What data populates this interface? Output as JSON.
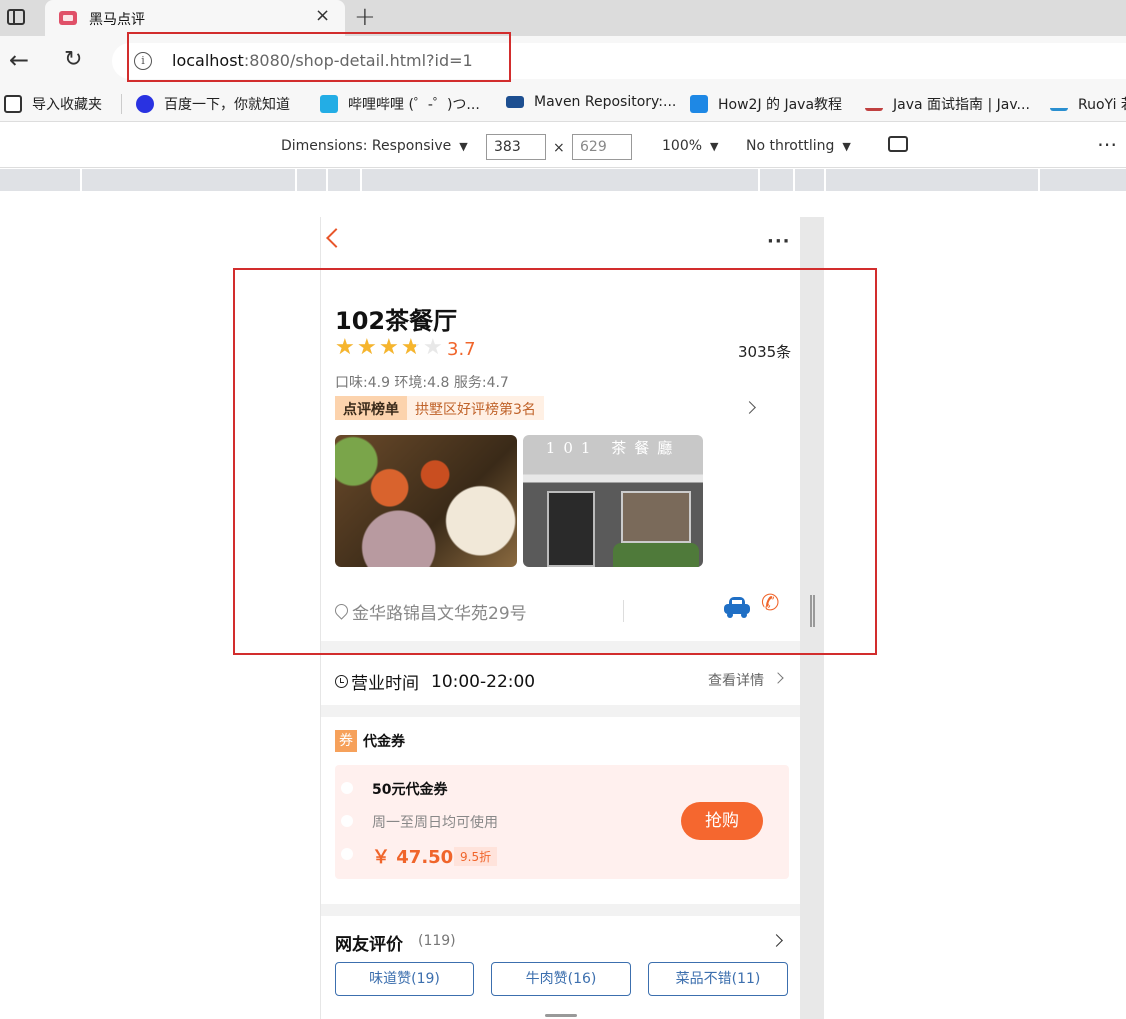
{
  "browser": {
    "tab_title": "黑马点评",
    "tab_close": "×",
    "new_tab": "+",
    "url_host": "localhost",
    "url_rest": ":8080/shop-detail.html?id=1",
    "back": "←",
    "reload": "↻",
    "info": "i"
  },
  "bookmarks": [
    {
      "label": "导入收藏夹",
      "icon": "import-icon",
      "color": "#333333"
    },
    {
      "label": "百度一下，你就知道",
      "icon": "baidu-icon",
      "color": "#2932e1"
    },
    {
      "label": "哔哩哔哩 (゜-゜)つ...",
      "icon": "bilibili-icon",
      "color": "#23ade5"
    },
    {
      "label": "Maven Repository:...",
      "icon": "maven-icon",
      "color": "#1d4f91"
    },
    {
      "label": "How2J 的 Java教程",
      "icon": "how2j-icon",
      "color": "#1e88e5"
    },
    {
      "label": "Java 面试指南 | Jav...",
      "icon": "java-guide-icon",
      "color": "#c04040"
    },
    {
      "label": "RuoYi 若",
      "icon": "ruoyi-icon",
      "color": "#2a8fd0"
    }
  ],
  "devtools": {
    "dimensions_label": "Dimensions: Responsive",
    "width": "383",
    "times": "×",
    "height": "629",
    "zoom": "100%",
    "throttling": "No throttling",
    "more": "⋯",
    "arrow": "▼"
  },
  "shop": {
    "name": "102茶餐厅",
    "rating": 3.7,
    "score_text": "3.7",
    "comments": "3035条",
    "sub_scores": "口味:4.9 环境:4.8 服务:4.7",
    "rank_tag": "点评榜单",
    "rank_text": "拱墅区好评榜第3名",
    "photo2_sign": "101 茶餐廳",
    "address": "金华路锦昌文华苑29号",
    "hours_label": "营业时间",
    "hours_time": "10:00-22:00",
    "hours_detail": "查看详情",
    "star_glyph": "★",
    "phone_glyph": "✆",
    "more_glyph": "···"
  },
  "voucher": {
    "badge": "券",
    "section_title": "代金券",
    "title": "50元代金券",
    "desc": "周一至周日均可使用",
    "price": "￥ 47.50",
    "discount": "9.5折",
    "buy_label": "抢购"
  },
  "reviews": {
    "title": "网友评价",
    "count": "(119)",
    "tags": [
      "味道赞(19)",
      "牛肉赞(16)",
      "菜品不错(11)"
    ]
  },
  "colors": {
    "accent": "#f0652b",
    "star": "#f6b52d",
    "link_blue": "#3c6fae",
    "annotation_red": "#d22d2d"
  }
}
